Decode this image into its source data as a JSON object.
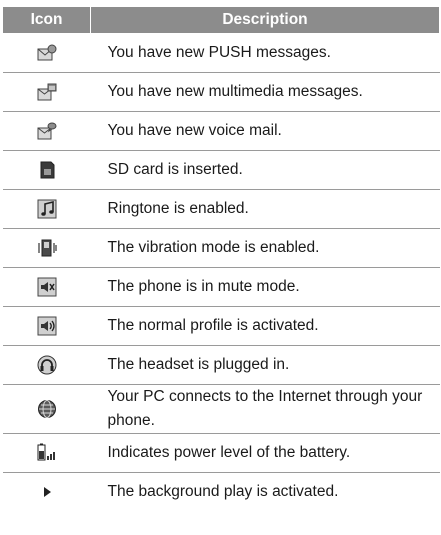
{
  "table": {
    "header": {
      "icon": "Icon",
      "description": "Description"
    },
    "rows": [
      {
        "icon": "push-message-icon",
        "text": "You have new PUSH messages."
      },
      {
        "icon": "multimedia-message-icon",
        "text": "You have new multimedia messages."
      },
      {
        "icon": "voice-mail-icon",
        "text": "You have new voice mail."
      },
      {
        "icon": "sd-card-icon",
        "text": "SD card is inserted."
      },
      {
        "icon": "ringtone-icon",
        "text": "Ringtone is enabled."
      },
      {
        "icon": "vibration-mode-icon",
        "text": "The vibration mode is enabled."
      },
      {
        "icon": "mute-mode-icon",
        "text": "The phone is in mute mode."
      },
      {
        "icon": "normal-profile-icon",
        "text": "The normal profile is activated."
      },
      {
        "icon": "headset-icon",
        "text": "The headset is plugged in."
      },
      {
        "icon": "pc-internet-icon",
        "text": "Your PC connects to the Internet through your phone."
      },
      {
        "icon": "battery-level-icon",
        "text": "Indicates power level of the battery."
      },
      {
        "icon": "background-play-icon",
        "text": "The background play is activated."
      }
    ]
  }
}
